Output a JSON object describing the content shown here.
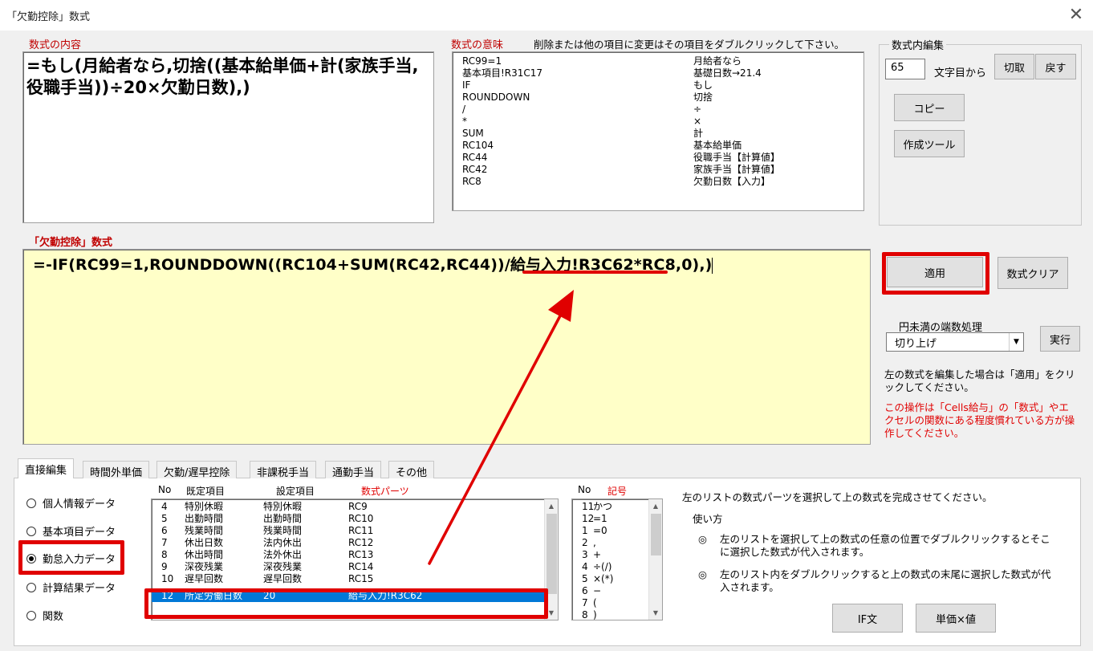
{
  "window": {
    "title": "「欠勤控除」数式",
    "close": "✕"
  },
  "formula_content": {
    "label": "数式の内容",
    "text": "=もし(月給者なら,切捨((基本給単価+計(家族手当,役職手当))÷20×欠勤日数),)"
  },
  "formula_meaning": {
    "label": "数式の意味",
    "hint": "削除または他の項目に変更はその項目をダブルクリックして下さい。",
    "rows": [
      {
        "code": "RC99=1",
        "meaning": "月給者なら"
      },
      {
        "code": "基本項目!R31C17",
        "meaning": "基礎日数→21.4"
      },
      {
        "code": "IF",
        "meaning": "もし"
      },
      {
        "code": "ROUNDDOWN",
        "meaning": "切捨"
      },
      {
        "code": "/",
        "meaning": "÷"
      },
      {
        "code": "*",
        "meaning": "×"
      },
      {
        "code": "SUM",
        "meaning": "計"
      },
      {
        "code": "RC104",
        "meaning": "基本給単価"
      },
      {
        "code": "RC44",
        "meaning": "役職手当【計算値】"
      },
      {
        "code": "RC42",
        "meaning": "家族手当【計算値】"
      },
      {
        "code": "RC8",
        "meaning": "欠勤日数【入力】"
      }
    ]
  },
  "edit_group": {
    "title": "数式内編集",
    "position_value": "65",
    "position_label": "文字目から",
    "cut": "切取",
    "undo": "戻す",
    "copy": "コピー",
    "tool": "作成ツール"
  },
  "main_formula": {
    "label": "「欠勤控除」数式",
    "part1": "=-IF(RC99=1,ROUNDDOWN((RC104+SUM(RC42,RC44))/",
    "part2": "給与入力!R3C62",
    "part3": "*RC8,0),)"
  },
  "actions": {
    "apply": "適用",
    "clear": "数式クリア",
    "rounding_label": "円未満の端数処理",
    "rounding_value": "切り上げ",
    "execute": "実行",
    "note1": "左の数式を編集した場合は「適用」をクリックしてください。",
    "warning": "この操作は「Cells給与」の「数式」やエクセルの関数にある程度慣れている方が操作してください。"
  },
  "tabs": [
    "直接編集",
    "時間外単価",
    "欠勤/遅早控除",
    "非課税手当",
    "通勤手当",
    "その他"
  ],
  "radios": [
    "個人情報データ",
    "基本項目データ",
    "勤怠入力データ",
    "計算結果データ",
    "関数"
  ],
  "parts_list": {
    "headers": {
      "no": "No",
      "item": "既定項目",
      "setting": "設定項目",
      "parts": "数式パーツ"
    },
    "rows": [
      {
        "no": "4",
        "item": "特別休暇",
        "setting": "特別休暇",
        "parts": "RC9"
      },
      {
        "no": "5",
        "item": "出勤時間",
        "setting": "出勤時間",
        "parts": "RC10"
      },
      {
        "no": "6",
        "item": "残業時間",
        "setting": "残業時間",
        "parts": "RC11"
      },
      {
        "no": "7",
        "item": "休出日数",
        "setting": "法内休出",
        "parts": "RC12"
      },
      {
        "no": "8",
        "item": "休出時間",
        "setting": "法外休出",
        "parts": "RC13"
      },
      {
        "no": "9",
        "item": "深夜残業",
        "setting": "深夜残業",
        "parts": "RC14"
      },
      {
        "no": "10",
        "item": "遅早回数",
        "setting": "遅早回数",
        "parts": "RC15"
      },
      {
        "no": "12",
        "item": "所定労働日数",
        "setting": "20",
        "parts": "給与入力!R3C62"
      }
    ]
  },
  "symbols": {
    "headers": {
      "no": "No",
      "sym": "記号"
    },
    "rows": [
      {
        "no": "11",
        "sym": "かつ"
      },
      {
        "no": "12",
        "sym": "=1"
      },
      {
        "no": "1",
        "sym": "=0"
      },
      {
        "no": "2",
        "sym": ","
      },
      {
        "no": "3",
        "sym": "+"
      },
      {
        "no": "4",
        "sym": "÷(/)"
      },
      {
        "no": "5",
        "sym": "×(*)"
      },
      {
        "no": "6",
        "sym": "−"
      },
      {
        "no": "7",
        "sym": "("
      },
      {
        "no": "8",
        "sym": ")"
      }
    ]
  },
  "instructions": {
    "line1": "左のリストの数式パーツを選択して上の数式を完成させてください。",
    "usage": "使い方",
    "bullet": "◎",
    "step1": "左のリストを選択して上の数式の任意の位置でダブルクリックするとそこに選択した数式が代入されます。",
    "step2": "左のリスト内をダブルクリックすると上の数式の末尾に選択した数式が代入されます。",
    "if_button": "IF文",
    "unit_button": "単価×値"
  },
  "colors": {
    "accent_red": "#e00000",
    "label_red": "#c00000",
    "selection_blue": "#0078d7",
    "formula_bg": "#ffffc8"
  }
}
